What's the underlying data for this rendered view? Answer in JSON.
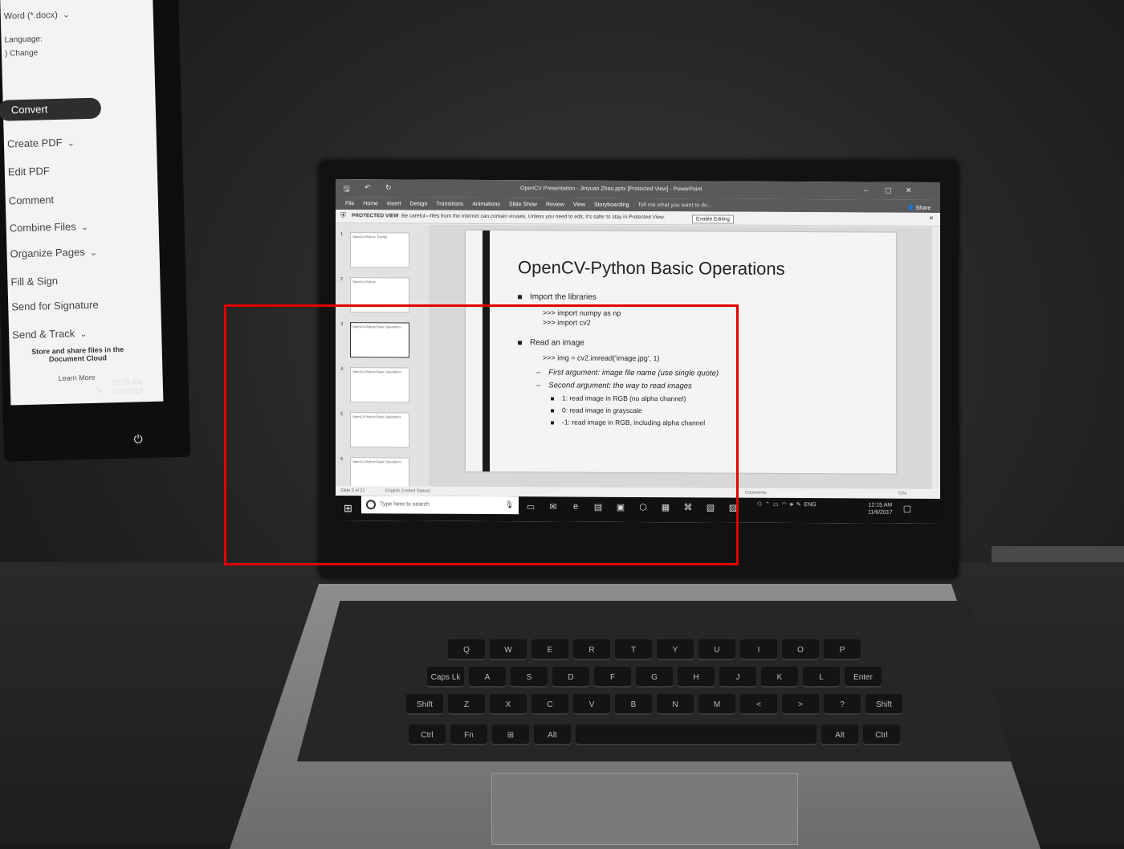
{
  "acrobat": {
    "save_as_label": "Word (*.docx)",
    "language_label": "Language:",
    "change_label": ") Change",
    "convert_label": "Convert",
    "tools": [
      {
        "label": "Create PDF",
        "chevron": true
      },
      {
        "label": "Edit PDF",
        "chevron": false
      },
      {
        "label": "Comment",
        "chevron": false
      },
      {
        "label": "Combine Files",
        "chevron": true
      },
      {
        "label": "Organize Pages",
        "chevron": true
      },
      {
        "label": "Fill & Sign",
        "chevron": false
      },
      {
        "label": "Send for Signature",
        "chevron": false
      },
      {
        "label": "Send & Track",
        "chevron": true
      }
    ],
    "cloud_text": "Store and share files in the Document Cloud",
    "learn_more": "Learn More",
    "time": "12:15 AM",
    "date": "11/6/2017"
  },
  "powerpoint": {
    "window_title": "OpenCV Presentation - Jinyuan Zhao.pptx [Protected View] - PowerPoint",
    "tabs": [
      "File",
      "Home",
      "Insert",
      "Design",
      "Transitions",
      "Animations",
      "Slide Show",
      "Review",
      "View",
      "Storyboarding"
    ],
    "tell_me": "Tell me what you want to do...",
    "share": "Share",
    "protected_label": "PROTECTED VIEW",
    "protected_message": "Be careful—files from the Internet can contain viruses. Unless you need to edit, it's safer to stay in Protected View.",
    "enable_editing": "Enable Editing",
    "thumbnails": [
      {
        "num": "1",
        "title": "OpenCV-Python Tutorial"
      },
      {
        "num": "2",
        "title": "OpenCV-Python"
      },
      {
        "num": "3",
        "title": "OpenCV-Python Basic Operations"
      },
      {
        "num": "4",
        "title": "OpenCV-Python Basic Operations"
      },
      {
        "num": "5",
        "title": "OpenCV-Python Basic Operations"
      },
      {
        "num": "6",
        "title": "OpenCV-Python Basic Operations"
      }
    ],
    "slide": {
      "title": "OpenCV-Python Basic Operations",
      "b1": "Import the libraries",
      "b1_l1": ">>> import numpy as np",
      "b1_l2": ">>> import cv2",
      "b2": "Read an image",
      "b2_l1": ">>> img = cv2.imread('image.jpg', 1)",
      "b2_s1": "First argument: image file name (use single quote)",
      "b2_s2": "Second argument: the way to read images",
      "b2_s2_1": "1: read image in RGB (no alpha channel)",
      "b2_s2_2": "0: read image in grayscale",
      "b2_s2_3": "-1: read image in RGB, including alpha channel"
    },
    "status_slide": "Slide 3 of 21",
    "status_lang": "English (United States)",
    "status_comments": "Comments",
    "zoom": "72%"
  },
  "taskbar": {
    "search_placeholder": "Type here to search",
    "lang": "ENG",
    "time": "12:15 AM",
    "date": "11/6/2017"
  },
  "keyboard": {
    "row1": [
      "Q",
      "W",
      "E",
      "R",
      "T",
      "Y",
      "U",
      "I",
      "O",
      "P"
    ],
    "row2": [
      "Caps Lk",
      "A",
      "S",
      "D",
      "F",
      "G",
      "H",
      "J",
      "K",
      "L",
      "Enter"
    ],
    "row3": [
      "Shift",
      "Z",
      "X",
      "C",
      "V",
      "B",
      "N",
      "M",
      "<",
      ">",
      "?",
      "Shift"
    ],
    "row4": [
      "Ctrl",
      "Fn",
      "⊞",
      "Alt",
      "",
      "Alt",
      "Ctrl"
    ]
  }
}
